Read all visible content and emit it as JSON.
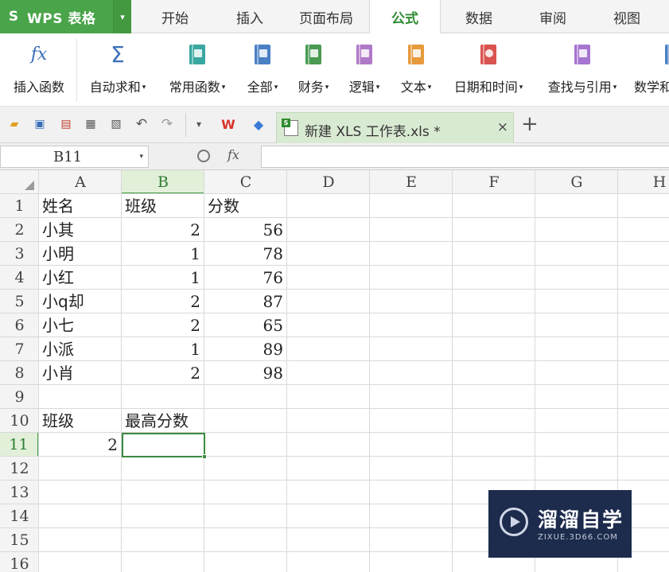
{
  "app": {
    "logo": "S",
    "title": "WPS 表格",
    "caret": "▾"
  },
  "menu": {
    "tabs": [
      "开始",
      "插入",
      "页面布局",
      "公式",
      "数据",
      "审阅",
      "视图"
    ],
    "active": "公式"
  },
  "ribbon": {
    "buttons": [
      {
        "label": "插入函数",
        "icon": "fx-icon",
        "dropdown": false
      },
      {
        "label": "自动求和",
        "icon": "sigma-icon",
        "dropdown": true
      },
      {
        "label": "常用函数",
        "icon": "star-book-icon",
        "dropdown": true
      },
      {
        "label": "全部",
        "icon": "list-book-icon",
        "dropdown": true
      },
      {
        "label": "财务",
        "icon": "finance-book-icon",
        "dropdown": true
      },
      {
        "label": "逻辑",
        "icon": "question-book-icon",
        "dropdown": true
      },
      {
        "label": "文本",
        "icon": "text-book-icon",
        "dropdown": true
      },
      {
        "label": "日期和时间",
        "icon": "clock-book-icon",
        "dropdown": true
      },
      {
        "label": "查找与引用",
        "icon": "search-book-icon",
        "dropdown": true
      },
      {
        "label": "数学和",
        "icon": "math-book-icon",
        "dropdown": false
      }
    ],
    "colors": {
      "star": "#3aa7a0",
      "list": "#4a7fc4",
      "finance": "#4a9a52",
      "question": "#b07ac8",
      "text": "#e69a3c",
      "clock": "#d9534f",
      "search": "#a675d0",
      "fx": "#3a6fb8",
      "sigma": "#3a6fb8"
    }
  },
  "quickbar": {
    "tab_title": "新建 XLS 工作表.xls *",
    "close": "×",
    "new_tab": "+",
    "dropdown": "▾"
  },
  "formula_bar": {
    "name_box": "B11",
    "fx": "fx",
    "formula": ""
  },
  "grid": {
    "columns": [
      "A",
      "B",
      "C",
      "D",
      "E",
      "F",
      "G",
      "H"
    ],
    "rows": [
      "1",
      "2",
      "3",
      "4",
      "5",
      "6",
      "7",
      "8",
      "9",
      "10",
      "11",
      "12",
      "13",
      "14",
      "15",
      "16"
    ],
    "active_cell": "B11",
    "table": {
      "header": [
        "姓名",
        "班级",
        "分数"
      ],
      "data": [
        [
          "小其",
          "2",
          "56"
        ],
        [
          "小明",
          "1",
          "78"
        ],
        [
          "小红",
          "1",
          "76"
        ],
        [
          "小q却",
          "2",
          "87"
        ],
        [
          "小七",
          "2",
          "65"
        ],
        [
          "小派",
          "1",
          "89"
        ],
        [
          "小肖",
          "2",
          "98"
        ]
      ]
    },
    "lookup": {
      "label_a": "班级",
      "label_b": "最高分数",
      "value_a": "2",
      "value_b": ""
    }
  },
  "watermark": {
    "title": "溜溜自学",
    "subtitle": "ZIXUE.3D66.COM"
  }
}
